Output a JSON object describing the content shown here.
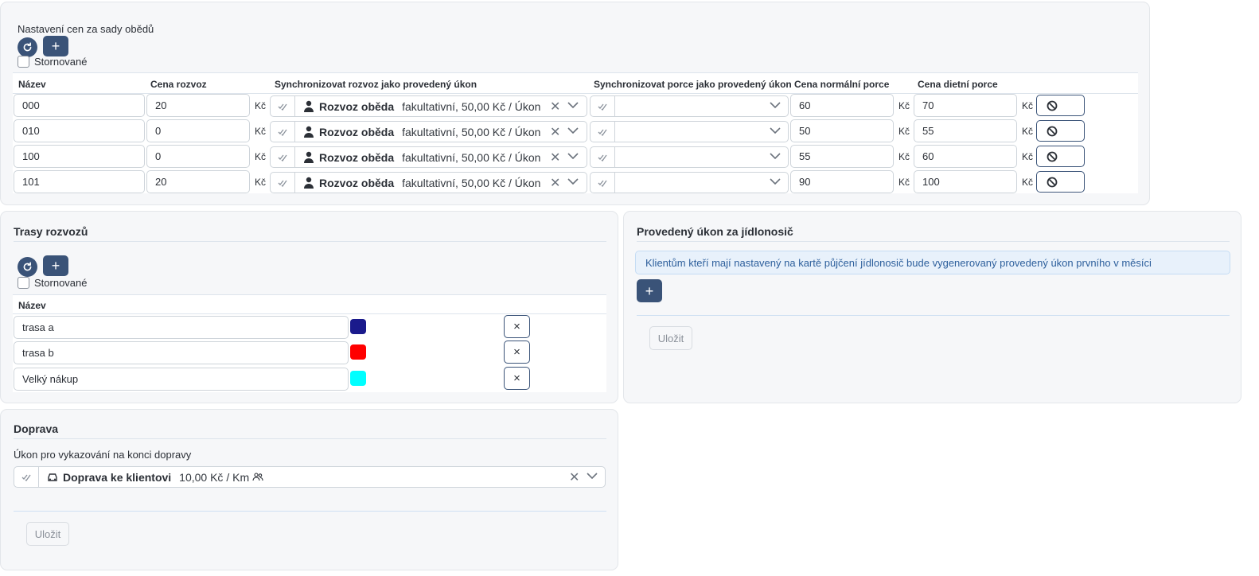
{
  "prices": {
    "title": "Nastavení cen za sady obědů",
    "cancelled_label": "Stornované",
    "add_label": "+",
    "headers": {
      "name": "Název",
      "delivery_price": "Cena rozvoz",
      "sync_delivery": "Synchronizovat rozvoz jako provedený úkon",
      "sync_portion": "Synchronizovat porce jako provedený úkon",
      "normal_price": "Cena normální porce",
      "diet_price": "Cena dietní porce"
    },
    "currency": "Kč",
    "rows": [
      {
        "name": "000",
        "delivery": "20",
        "service": "Rozvoz oběda",
        "service_detail": "fakultativní, 50,00 Kč / Úkon",
        "normal": "60",
        "diet": "70"
      },
      {
        "name": "010",
        "delivery": "0",
        "service": "Rozvoz oběda",
        "service_detail": "fakultativní, 50,00 Kč / Úkon",
        "normal": "50",
        "diet": "55"
      },
      {
        "name": "100",
        "delivery": "0",
        "service": "Rozvoz oběda",
        "service_detail": "fakultativní, 50,00 Kč / Úkon",
        "normal": "55",
        "diet": "60"
      },
      {
        "name": "101",
        "delivery": "20",
        "service": "Rozvoz oběda",
        "service_detail": "fakultativní, 50,00 Kč / Úkon",
        "normal": "90",
        "diet": "100"
      }
    ]
  },
  "routes": {
    "title": "Trasy rozvozů",
    "cancelled_label": "Stornované",
    "add_label": "+",
    "header_name": "Název",
    "remove_label": "×",
    "rows": [
      {
        "name": "trasa a",
        "color": "#1a1a8c"
      },
      {
        "name": "trasa b",
        "color": "#ff0000"
      },
      {
        "name": "Velký nákup",
        "color": "#00ffff"
      }
    ]
  },
  "feeding": {
    "title": "Provedený úkon za jídlonosič",
    "info": "Klientům kteří mají nastavený na kartě půjčení jídlonosič bude vygenerovaný provedený úkon prvního v měsíci",
    "add_label": "+",
    "save_label": "Uložit"
  },
  "transport": {
    "title": "Doprava",
    "field_label": "Úkon pro vykazování na konci dopravy",
    "service": "Doprava ke klientovi",
    "service_detail": "10,00 Kč / Km",
    "clear_label": "×",
    "save_label": "Uložit"
  },
  "colors": {
    "accent": "#3a5378",
    "card_bg": "#f6f7f9",
    "info_text": "#2d5f9c"
  }
}
